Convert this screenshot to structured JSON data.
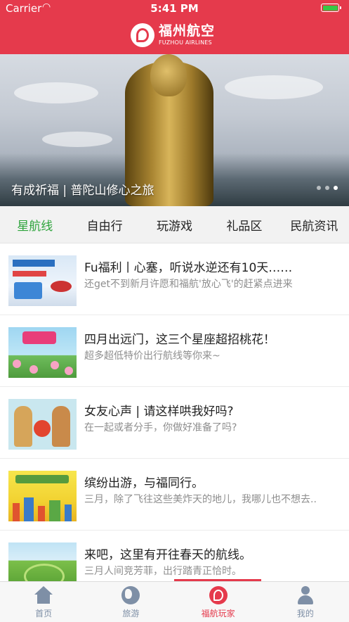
{
  "status_bar": {
    "carrier": "Carrier",
    "wifi_icon": "wifi-icon",
    "time": "5:41 PM",
    "battery_icon": "battery-icon"
  },
  "header": {
    "brand_cn": "福州航空",
    "brand_en": "FUZHOU AIRLINES",
    "logo_icon": "fuzhou-airlines-logo"
  },
  "banner": {
    "caption": "有成祈福 | 普陀山修心之旅",
    "page_count": 3,
    "active_page": 3
  },
  "tabs": [
    {
      "label": "星航线",
      "active": true
    },
    {
      "label": "自由行",
      "active": false
    },
    {
      "label": "玩游戏",
      "active": false
    },
    {
      "label": "礼品区",
      "active": false
    },
    {
      "label": "民航资讯",
      "active": false
    }
  ],
  "articles": [
    {
      "title": "Fu福利丨心塞，听说水逆还有10天……",
      "desc": "还get不到新月许愿和福航'放心飞'的赶紧点进来"
    },
    {
      "title": "四月出远门，这三个星座超招桃花！",
      "desc": "超多超低特价出行航线等你来~"
    },
    {
      "title": "女友心声 | 请这样哄我好吗?",
      "desc": "在一起或者分手，你做好准备了吗?"
    },
    {
      "title": "缤纷出游，与福同行。",
      "desc": "三月，除了飞往这些美炸天的地儿，我哪儿也不想去.."
    },
    {
      "title": "来吧，这里有开往春天的航线。",
      "desc": "三月人间竞芳菲，出行踏青正恰时。"
    }
  ],
  "tabbar": [
    {
      "label": "首页",
      "icon": "home-icon",
      "active": false
    },
    {
      "label": "旅游",
      "icon": "globe-icon",
      "active": false
    },
    {
      "label": "福航玩家",
      "icon": "fuzhou-airlines-icon",
      "active": true
    },
    {
      "label": "我的",
      "icon": "person-icon",
      "active": false
    }
  ],
  "colors": {
    "brand_red": "#e53a4c",
    "active_tab_green": "#2ea43c",
    "tabbar_inactive": "#7e8fa6"
  }
}
